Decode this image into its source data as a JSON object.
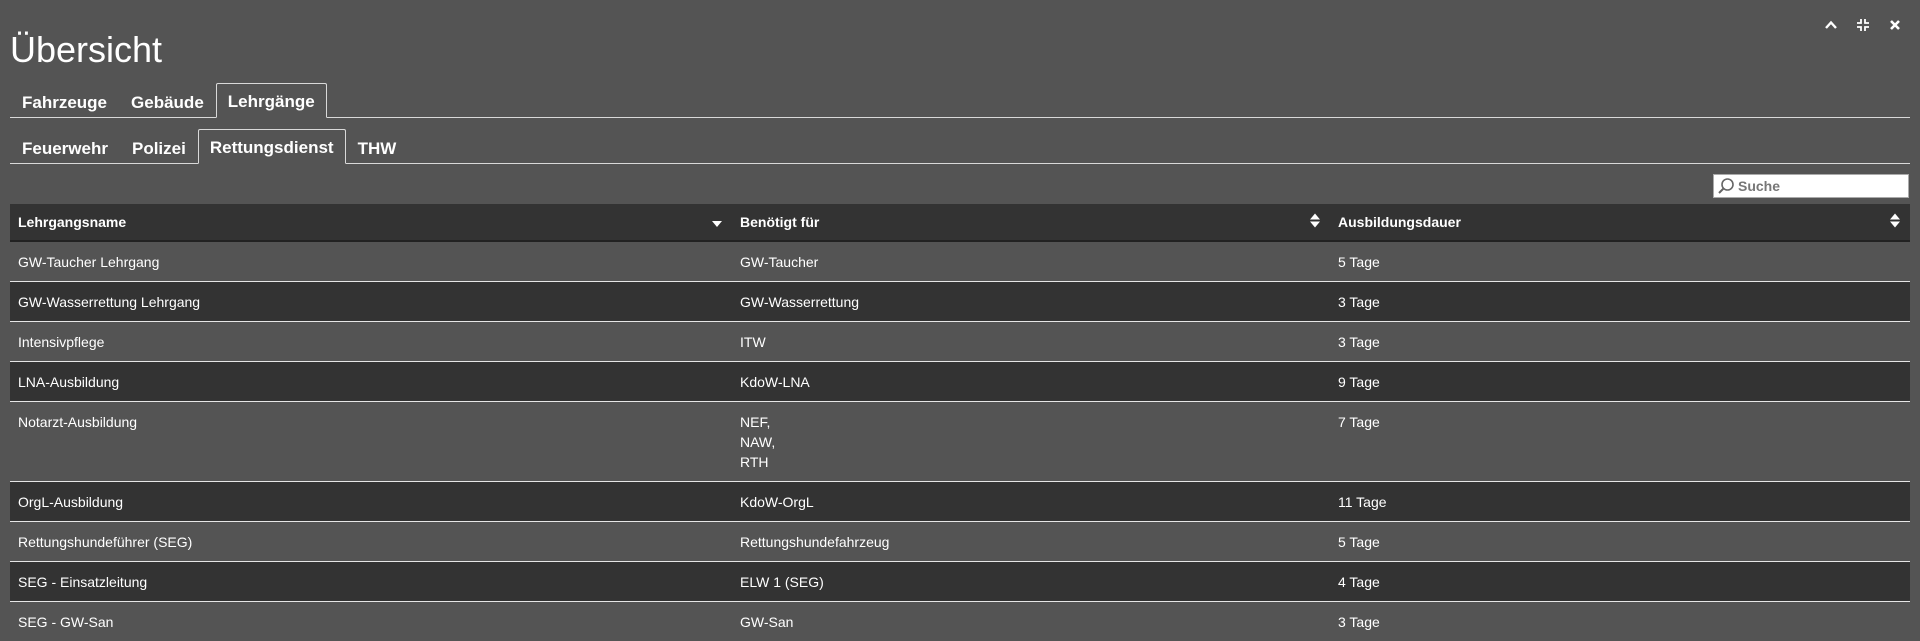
{
  "window": {
    "title": "Übersicht",
    "controls": [
      "chevron-up-icon",
      "compress-icon",
      "close-icon"
    ]
  },
  "main_tabs": [
    {
      "label": "Fahrzeuge",
      "active": false
    },
    {
      "label": "Gebäude",
      "active": false
    },
    {
      "label": "Lehrgänge",
      "active": true
    }
  ],
  "sub_tabs": [
    {
      "label": "Feuerwehr",
      "active": false
    },
    {
      "label": "Polizei",
      "active": false
    },
    {
      "label": "Rettungsdienst",
      "active": true
    },
    {
      "label": "THW",
      "active": false
    }
  ],
  "search": {
    "placeholder": "Suche",
    "value": ""
  },
  "table": {
    "headers": [
      "Lehrgangsname",
      "Benötigt für",
      "Ausbildungsdauer"
    ],
    "sort": [
      "desc",
      "both",
      "both"
    ],
    "rows": [
      {
        "name": "GW-Taucher Lehrgang",
        "needed_for": [
          "GW-Taucher"
        ],
        "duration": "5 Tage"
      },
      {
        "name": "GW-Wasserrettung Lehrgang",
        "needed_for": [
          "GW-Wasserrettung"
        ],
        "duration": "3 Tage"
      },
      {
        "name": "Intensivpflege",
        "needed_for": [
          "ITW"
        ],
        "duration": "3 Tage"
      },
      {
        "name": "LNA-Ausbildung",
        "needed_for": [
          "KdoW-LNA"
        ],
        "duration": "9 Tage"
      },
      {
        "name": "Notarzt-Ausbildung",
        "needed_for": [
          "NEF,",
          "NAW,",
          "RTH"
        ],
        "duration": "7 Tage"
      },
      {
        "name": "OrgL-Ausbildung",
        "needed_for": [
          "KdoW-OrgL"
        ],
        "duration": "11 Tage"
      },
      {
        "name": "Rettungshundeführer (SEG)",
        "needed_for": [
          "Rettungshundefahrzeug"
        ],
        "duration": "5 Tage"
      },
      {
        "name": "SEG - Einsatzleitung",
        "needed_for": [
          "ELW 1 (SEG)"
        ],
        "duration": "4 Tage"
      },
      {
        "name": "SEG - GW-San",
        "needed_for": [
          "GW-San"
        ],
        "duration": "3 Tage"
      }
    ]
  },
  "colors": {
    "background": "#545454",
    "row_dark": "#333333",
    "text": "#ffffff"
  }
}
